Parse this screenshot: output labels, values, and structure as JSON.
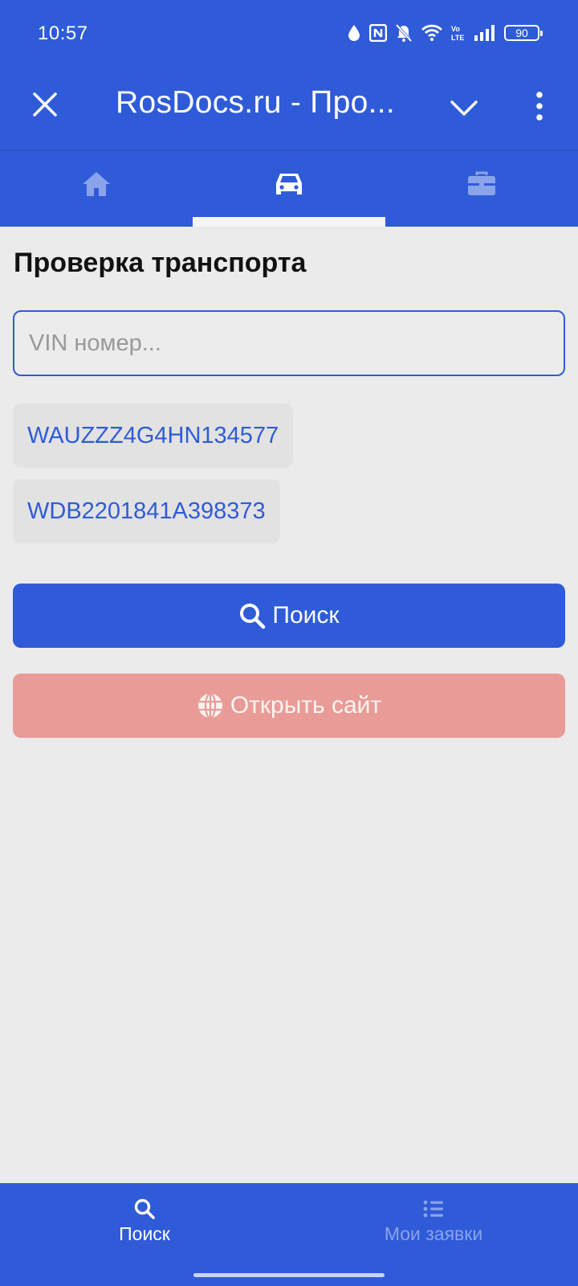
{
  "status_bar": {
    "time": "10:57",
    "battery": "90",
    "icons": [
      "water-drop-icon",
      "nfc-icon",
      "bell-off-icon",
      "wifi-icon",
      "volte-icon",
      "signal-icon",
      "battery-icon"
    ]
  },
  "title_bar": {
    "title": "RosDocs.ru - Про...",
    "close_icon": "close-icon",
    "expand_icon": "chevron-down-icon",
    "menu_icon": "more-vertical-icon"
  },
  "tabs": [
    {
      "icon": "home-icon",
      "active": false
    },
    {
      "icon": "car-icon",
      "active": true
    },
    {
      "icon": "briefcase-icon",
      "active": false
    }
  ],
  "main": {
    "heading": "Проверка транспорта",
    "vin_input": {
      "placeholder": "VIN номер...",
      "value": ""
    },
    "vin_history": [
      "WAUZZZ4G4HN134577",
      "WDB2201841A398373"
    ],
    "search_button": "Поиск",
    "open_site_button": "Открыть сайт"
  },
  "bottom_nav": [
    {
      "label": "Поиск",
      "icon": "search-icon",
      "active": true
    },
    {
      "label": "Мои заявки",
      "icon": "list-icon",
      "active": false
    }
  ],
  "colors": {
    "primary": "#2f5bd8",
    "background": "#ebebeb",
    "open_site_button": "#e99c97"
  }
}
